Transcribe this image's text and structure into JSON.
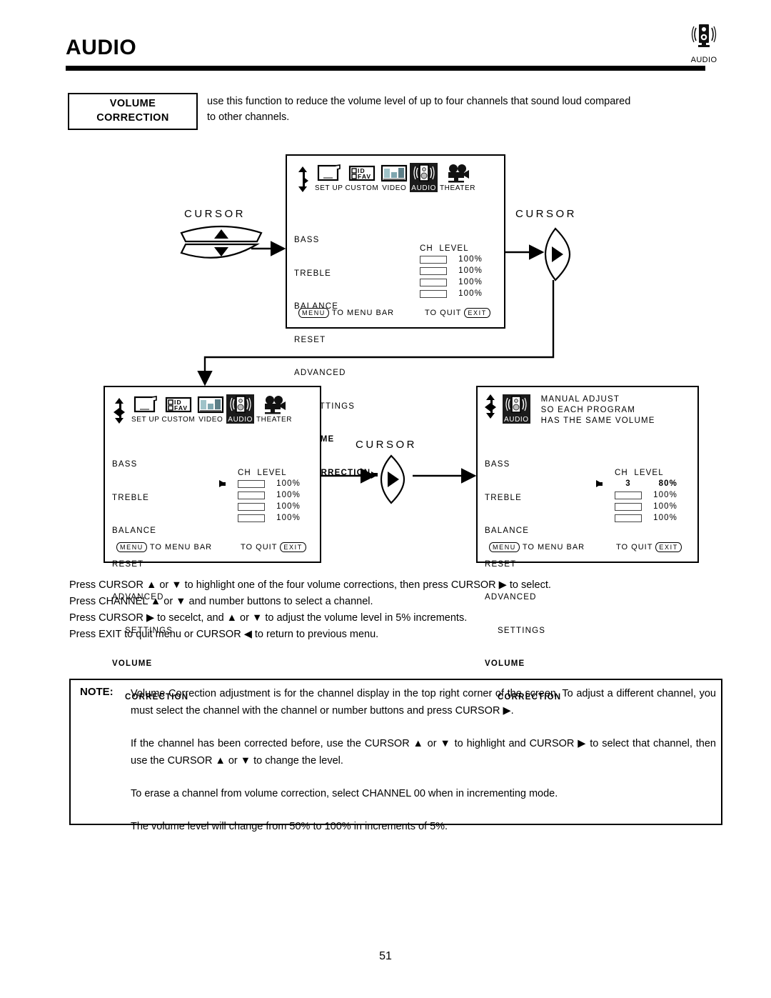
{
  "header": {
    "title": "AUDIO",
    "icon_name": "speaker-icon",
    "icon_label": "AUDIO"
  },
  "callout": {
    "line1": "VOLUME",
    "line2": "CORRECTION",
    "description_l1": "use this function to reduce the volume level of up to four channels that sound loud compared",
    "description_l2": "to other channels."
  },
  "menu_bar": {
    "items": [
      {
        "label": "SET UP",
        "icon": "tv-setup-icon"
      },
      {
        "label": "CUSTOM",
        "icon": "id-fav-icon",
        "sub": [
          "ID",
          "FAV"
        ]
      },
      {
        "label": "VIDEO",
        "icon": "video-bars-icon"
      },
      {
        "label": "AUDIO",
        "icon": "speaker-icon",
        "selected": true
      },
      {
        "label": "THEATER",
        "icon": "film-camera-icon"
      }
    ]
  },
  "menu_items": {
    "bass": "BASS",
    "treble": "TREBLE",
    "balance": "BALANCE",
    "reset": "RESET",
    "advanced": "ADVANCED",
    "settings": "SETTINGS",
    "volume": "VOLUME",
    "correction": "CORRECTION"
  },
  "level_header": "CH  LEVEL",
  "footer": {
    "menu_key": "MENU",
    "menu_text": "TO MENU BAR",
    "quit_text": "TO QUIT",
    "exit_key": "EXIT"
  },
  "panels": {
    "panel1": {
      "name": "volume-correction-entry-screen",
      "levels": [
        {
          "ch": "",
          "pct": "100%"
        },
        {
          "ch": "",
          "pct": "100%"
        },
        {
          "ch": "",
          "pct": "100%"
        },
        {
          "ch": "",
          "pct": "100%"
        }
      ],
      "pointer": "correction"
    },
    "panel2": {
      "name": "volume-correction-row-selected-screen",
      "levels": [
        {
          "ch": "",
          "pct": "100%"
        },
        {
          "ch": "",
          "pct": "100%"
        },
        {
          "ch": "",
          "pct": "100%"
        },
        {
          "ch": "",
          "pct": "100%"
        }
      ],
      "pointer": "level-row-1"
    },
    "panel3": {
      "name": "volume-correction-adjusted-screen",
      "help_l1": "MANUAL ADJUST",
      "help_l2": "SO EACH PROGRAM",
      "help_l3": "HAS THE SAME VOLUME",
      "levels": [
        {
          "ch": "3",
          "pct": "80%",
          "bold": true
        },
        {
          "ch": "",
          "pct": "100%"
        },
        {
          "ch": "",
          "pct": "100%"
        },
        {
          "ch": "",
          "pct": "100%"
        }
      ],
      "pointer": "level-row-1"
    }
  },
  "cursor_labels": {
    "left": "CURSOR",
    "right": "CURSOR",
    "middle": "CURSOR"
  },
  "instructions": [
    "Press CURSOR ▲ or ▼ to highlight one of the four volume corrections, then press CURSOR ▶ to select.",
    "Press CHANNEL ▲ or ▼ and number buttons to select a channel.",
    "Press CURSOR ▶ to secelct, and ▲ or ▼ to adjust the volume level in 5% increments.",
    "Press EXIT to quit menu or CURSOR ◀ to return to previous menu."
  ],
  "note": {
    "label": "NOTE:",
    "p1": "Volume Correction adjustment is for the channel display in the top right corner of the screen.  To adjust a different channel, you must select the channel with the channel or number buttons and press CURSOR ▶.",
    "p2": "If the channel has been corrected before, use the CURSOR ▲ or ▼ to highlight and CURSOR ▶ to select that channel, then use the CURSOR ▲ or ▼ to change the level.",
    "p3": "To erase a channel from volume correction, select CHANNEL 00 when in incrementing mode.",
    "p4": "The volume level will change from 50% to 100% in increments of 5%."
  },
  "page_number": "51"
}
